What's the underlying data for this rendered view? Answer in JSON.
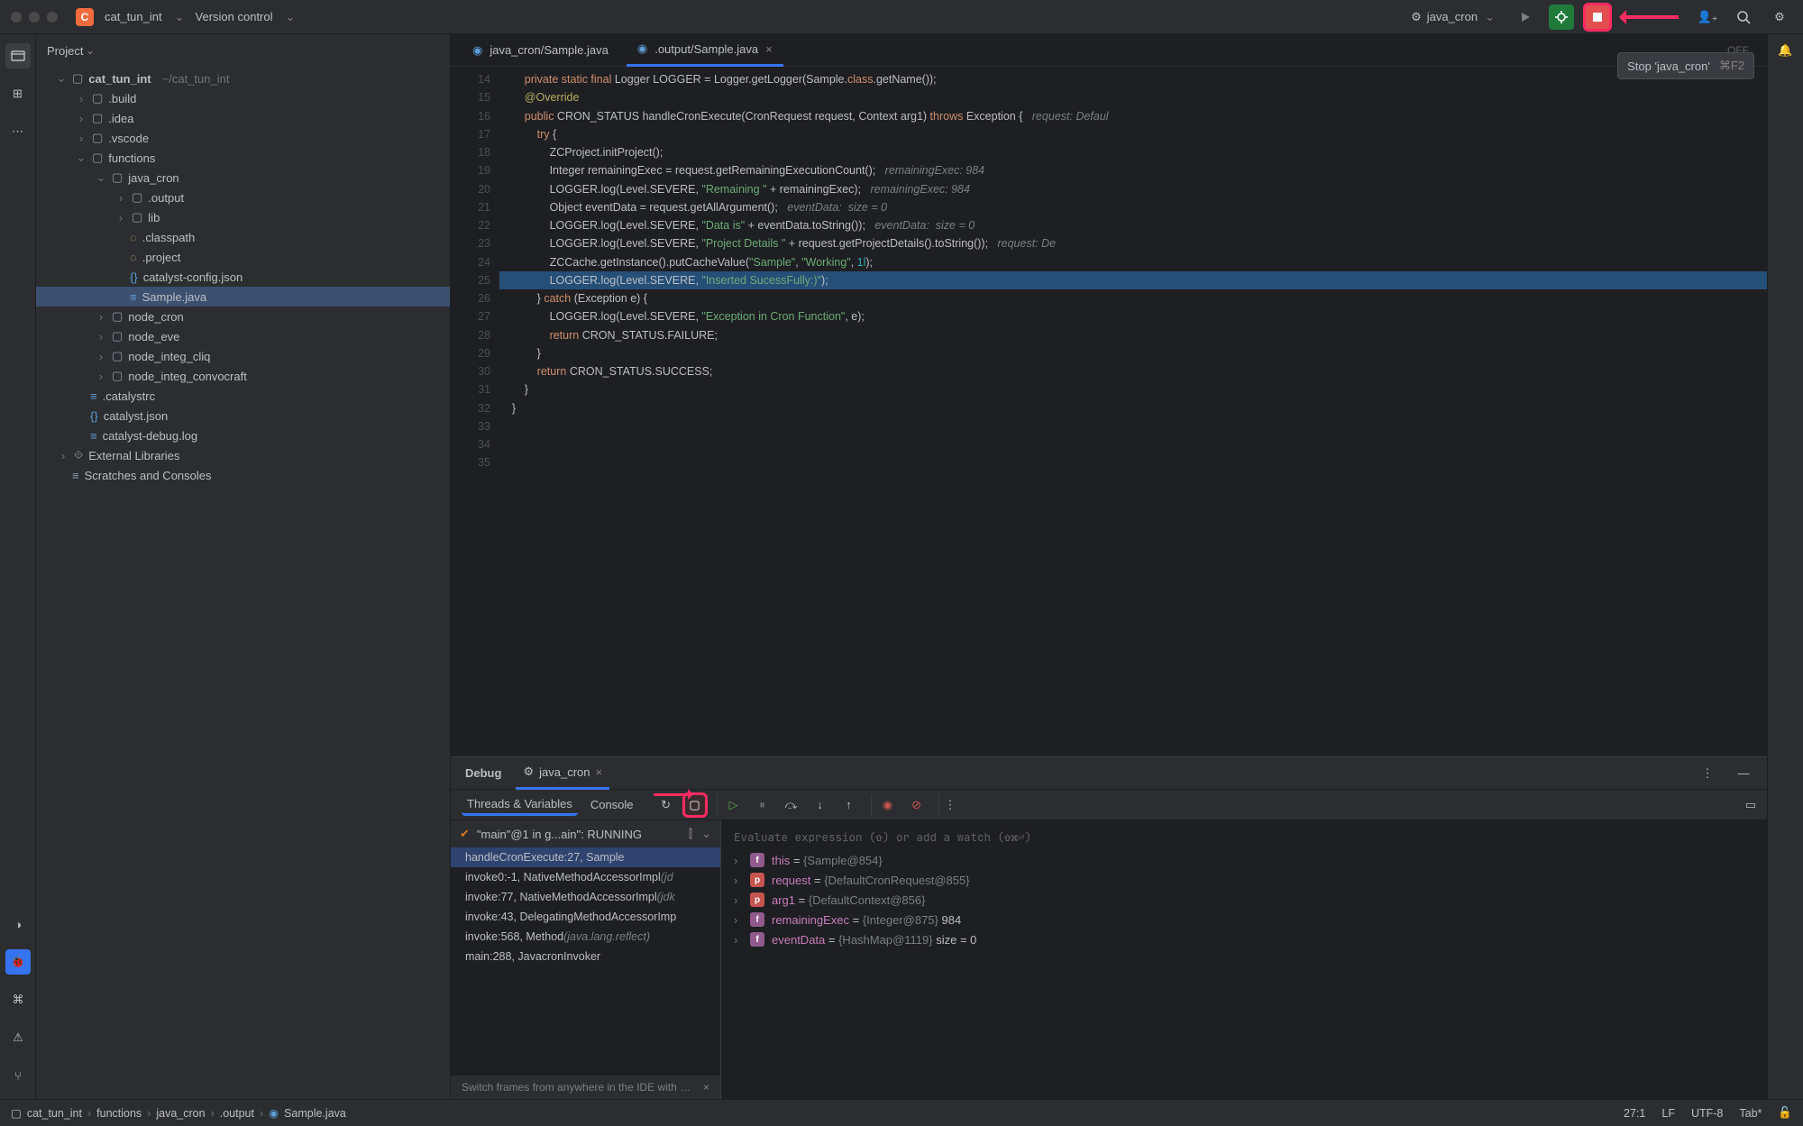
{
  "titlebar": {
    "project_badge": "C",
    "project_name": "cat_tun_int",
    "vcs_label": "Version control"
  },
  "run": {
    "config_label": "java_cron",
    "tooltip_text": "Stop 'java_cron'",
    "tooltip_kbd": "⌘F2"
  },
  "project_panel": {
    "title": "Project",
    "root_name": "cat_tun_int",
    "root_path": "~/cat_tun_int",
    "nodes": {
      "build": ".build",
      "idea": ".idea",
      "vscode": ".vscode",
      "functions": "functions",
      "java_cron": "java_cron",
      "output": ".output",
      "lib": "lib",
      "classpath": ".classpath",
      "project": ".project",
      "catalyst_config": "catalyst-config.json",
      "sample_java": "Sample.java",
      "node_cron": "node_cron",
      "node_eve": "node_eve",
      "node_integ_cliq": "node_integ_cliq",
      "node_integ_convocraft": "node_integ_convocraft",
      "catalystrc": ".catalystrc",
      "catalyst_json": "catalyst.json",
      "catalyst_debug_log": "catalyst-debug.log",
      "external_libs": "External Libraries",
      "scratches": "Scratches and Consoles"
    }
  },
  "tabs": {
    "tab1": "java_cron/Sample.java",
    "tab2": ".output/Sample.java",
    "off_label": "OFF"
  },
  "code": {
    "lines": {
      "l14": "",
      "l15_a": "        private static final",
      "l15_b": " Logger LOGGER = Logger.getLogger(Sample.",
      "l15_c": "class",
      "l15_d": ".getName());",
      "l16": "",
      "l17_a": "        ",
      "l17_b": "@Override",
      "l18_a": "        public",
      "l18_b": " CRON_STATUS handleCronExecute(CronRequest request, Context arg1) ",
      "l18_c": "throws",
      "l18_d": " Exception {   ",
      "l18_e": "request: Defaul",
      "l19_a": "            try",
      "l19_b": " {",
      "l20": "                ZCProject.initProject();",
      "l21_a": "                Integer remainingExec = request.getRemainingExecutionCount();   ",
      "l21_b": "remainingExec: 984",
      "l22_a": "                LOGGER.log(Level.SEVERE, ",
      "l22_b": "\"Remaining \"",
      "l22_c": " + remainingExec);   ",
      "l22_d": "remainingExec: 984",
      "l23_a": "                Object eventData = request.getAllArgument();   ",
      "l23_b": "eventData:  size = 0",
      "l24_a": "                LOGGER.log(Level.SEVERE, ",
      "l24_b": "\"Data is\"",
      "l24_c": " + eventData.toString());   ",
      "l24_d": "eventData:  size = 0",
      "l25_a": "                LOGGER.log(Level.SEVERE, ",
      "l25_b": "\"Project Details \"",
      "l25_c": " + request.getProjectDetails().toString());   ",
      "l25_d": "request: De",
      "l26_a": "                ZCCache.getInstance().putCacheValue(",
      "l26_b": "\"Sample\"",
      "l26_c": ", ",
      "l26_d": "\"Working\"",
      "l26_e": ", ",
      "l26_f": "1l",
      "l26_g": ");",
      "l27_a": "                LOGGER.log(Level.SEVERE, ",
      "l27_b": "\"Inserted SucessFully:)\"",
      "l27_c": ");",
      "l28_a": "            } ",
      "l28_b": "catch",
      "l28_c": " (Exception e) {",
      "l29_a": "                LOGGER.log(Level.SEVERE, ",
      "l29_b": "\"Exception in Cron Function\"",
      "l29_c": ", e);",
      "l30_a": "                return",
      "l30_b": " CRON_STATUS.FAILURE;",
      "l31": "            }",
      "l32_a": "            return",
      "l32_b": " CRON_STATUS.SUCCESS;",
      "l33": "        }",
      "l34": "",
      "l35": "    }"
    },
    "gutter": [
      "14",
      "15",
      "16",
      "17",
      "18",
      "19",
      "20",
      "21",
      "22",
      "23",
      "24",
      "25",
      "26",
      "27",
      "28",
      "29",
      "30",
      "31",
      "32",
      "33",
      "34",
      "35"
    ]
  },
  "debug": {
    "title": "Debug",
    "subtab": "java_cron",
    "toolbar_tabs": {
      "threads": "Threads & Variables",
      "console": "Console"
    },
    "thread_label": "\"main\"@1 in g...ain\": RUNNING",
    "frames": [
      {
        "text": "handleCronExecute:27, Sample",
        "dim": ""
      },
      {
        "text": "invoke0:-1, NativeMethodAccessorImpl ",
        "dim": "(jd"
      },
      {
        "text": "invoke:77, NativeMethodAccessorImpl ",
        "dim": "(jdk"
      },
      {
        "text": "invoke:43, DelegatingMethodAccessorImp",
        "dim": ""
      },
      {
        "text": "invoke:568, Method ",
        "dim": "(java.lang.reflect)"
      },
      {
        "text": "main:288, JavacronInvoker",
        "dim": ""
      }
    ],
    "eval_hint": "Evaluate expression (⇧) or add a watch (⇧⌘⏎)",
    "vars": [
      {
        "kind": "f",
        "name": "this",
        "eq": " = ",
        "type": "{Sample@854}",
        "val": ""
      },
      {
        "kind": "p",
        "name": "request",
        "eq": " = ",
        "type": "{DefaultCronRequest@855}",
        "val": ""
      },
      {
        "kind": "p",
        "name": "arg1",
        "eq": " = ",
        "type": "{DefaultContext@856}",
        "val": ""
      },
      {
        "kind": "f",
        "name": "remainingExec",
        "eq": " = ",
        "type": "{Integer@875}",
        "val": " 984"
      },
      {
        "kind": "f",
        "name": "eventData",
        "eq": " = ",
        "type": "{HashMap@1119}",
        "val": "  size = 0"
      }
    ],
    "hint_strip": "Switch frames from anywhere in the IDE with …"
  },
  "breadcrumbs": {
    "items": [
      "cat_tun_int",
      "functions",
      "java_cron",
      ".output",
      "Sample.java"
    ]
  },
  "statusbar": {
    "pos": "27:1",
    "le": "LF",
    "enc": "UTF-8",
    "indent": "Tab*"
  }
}
